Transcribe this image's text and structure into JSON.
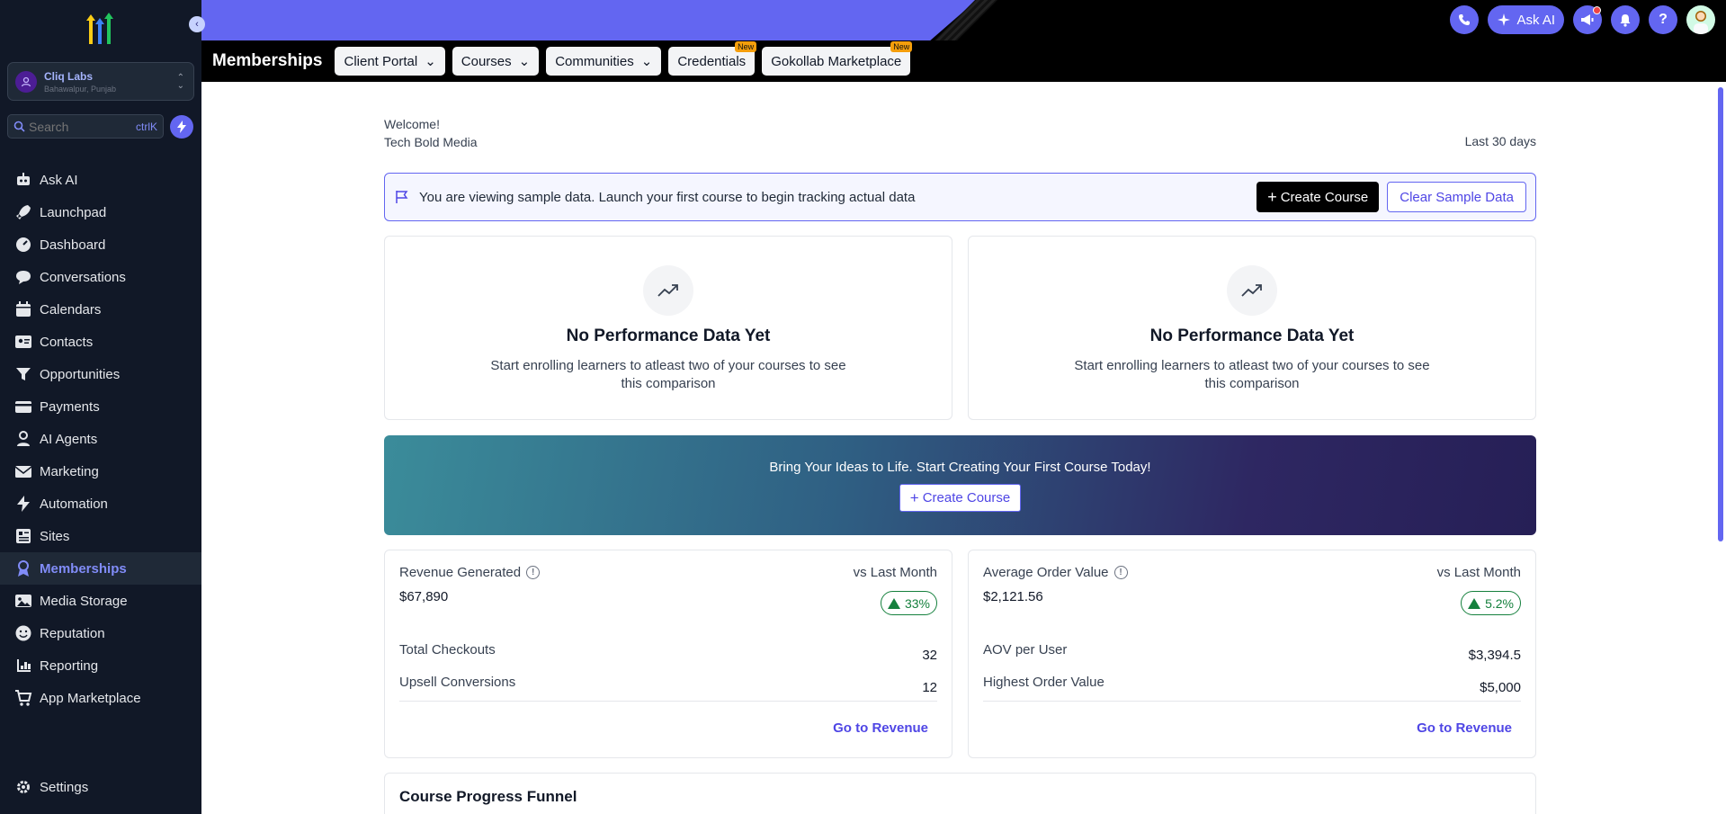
{
  "sidebar": {
    "account": {
      "name": "Cliq Labs",
      "location": "Bahawalpur, Punjab"
    },
    "search": {
      "placeholder": "Search",
      "shortcut": "ctrlK"
    },
    "items": [
      {
        "label": "Ask AI",
        "icon": "robot-icon"
      },
      {
        "label": "Launchpad",
        "icon": "rocket-icon"
      },
      {
        "label": "Dashboard",
        "icon": "gauge-icon"
      },
      {
        "label": "Conversations",
        "icon": "chat-icon"
      },
      {
        "label": "Calendars",
        "icon": "calendar-icon"
      },
      {
        "label": "Contacts",
        "icon": "contact-card-icon"
      },
      {
        "label": "Opportunities",
        "icon": "funnel-icon"
      },
      {
        "label": "Payments",
        "icon": "credit-card-icon"
      },
      {
        "label": "AI Agents",
        "icon": "agent-icon"
      },
      {
        "label": "Marketing",
        "icon": "envelope-icon"
      },
      {
        "label": "Automation",
        "icon": "lightning-icon"
      },
      {
        "label": "Sites",
        "icon": "sites-icon"
      },
      {
        "label": "Memberships",
        "icon": "membership-icon",
        "active": true
      },
      {
        "label": "Media Storage",
        "icon": "image-icon"
      },
      {
        "label": "Reputation",
        "icon": "smiley-icon"
      },
      {
        "label": "Reporting",
        "icon": "bar-chart-icon"
      },
      {
        "label": "App Marketplace",
        "icon": "cart-icon"
      }
    ],
    "settings_label": "Settings"
  },
  "topbar": {
    "ask_ai_label": "Ask AI"
  },
  "subnav": {
    "title": "Memberships",
    "tabs": [
      {
        "label": "Client Portal",
        "dropdown": true
      },
      {
        "label": "Courses",
        "dropdown": true
      },
      {
        "label": "Communities",
        "dropdown": true
      },
      {
        "label": "Credentials",
        "badge": "New"
      },
      {
        "label": "Gokollab Marketplace",
        "badge": "New"
      }
    ]
  },
  "main": {
    "welcome": "Welcome!",
    "org_name": "Tech Bold Media",
    "date_range": "Last 30 days",
    "sample_notice": {
      "message": "You are viewing sample data. Launch your first course to begin tracking actual data",
      "create_label": "Create Course",
      "clear_label": "Clear Sample Data"
    },
    "performance_cards": [
      {
        "title": "No Performance Data Yet",
        "text": "Start enrolling learners to atleast two of your courses to see this comparison"
      },
      {
        "title": "No Performance Data Yet",
        "text": "Start enrolling learners to atleast two of your courses to see this comparison"
      }
    ],
    "banner": {
      "text": "Bring Your Ideas to Life. Start Creating Your First Course Today!",
      "button_label": "Create Course"
    },
    "stats": [
      {
        "title": "Revenue Generated",
        "compare": "vs Last Month",
        "value": "$67,890",
        "change": "33%",
        "rows": [
          {
            "label": "Total Checkouts",
            "value": "32"
          },
          {
            "label": "Upsell Conversions",
            "value": "12"
          }
        ],
        "link": "Go to Revenue"
      },
      {
        "title": "Average Order Value",
        "compare": "vs Last Month",
        "value": "$2,121.56",
        "change": "5.2%",
        "rows": [
          {
            "label": "AOV per User",
            "value": "$3,394.5"
          },
          {
            "label": "Highest Order Value",
            "value": "$5,000"
          }
        ],
        "link": "Go to Revenue"
      }
    ],
    "funnel_title": "Course Progress Funnel"
  },
  "colors": {
    "accent": "#6366f1",
    "sidebar_bg": "#111827",
    "positive": "#15803d"
  }
}
